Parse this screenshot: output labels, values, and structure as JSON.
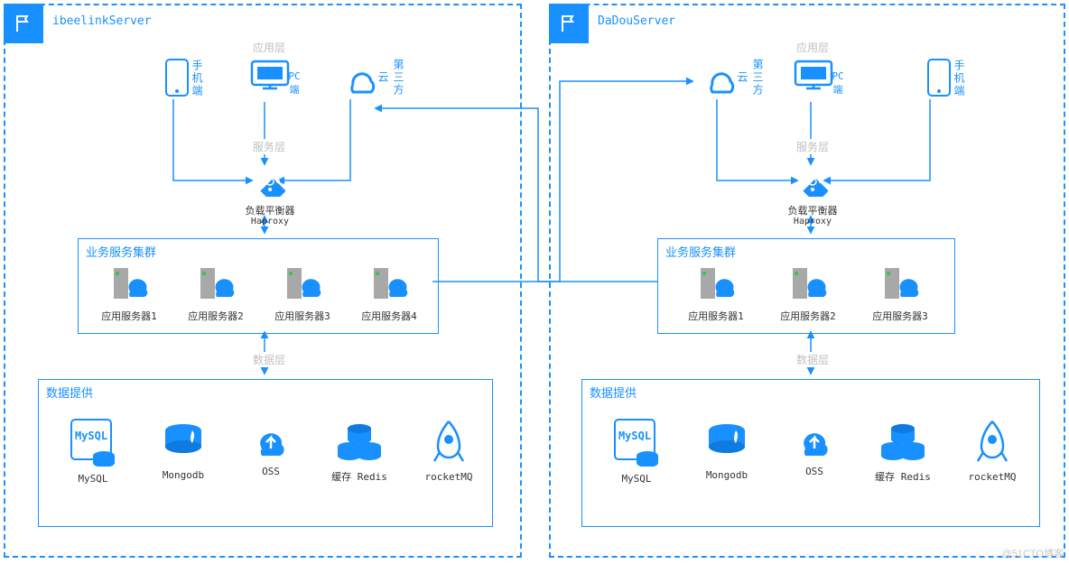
{
  "servers": {
    "left": {
      "title": "ibeelinkServer"
    },
    "right": {
      "title": "DaDouServer"
    }
  },
  "layers": {
    "app": "应用层",
    "service": "服务层",
    "data": "数据层"
  },
  "clients": {
    "mobile": "手机端",
    "pc": "PC端",
    "thirdparty": "第三方云"
  },
  "lb": {
    "label": "负载平衡器",
    "sub": "Haproxy"
  },
  "cluster": {
    "title": "业务服务集群"
  },
  "apps_left": [
    "应用服务器1",
    "应用服务器2",
    "应用服务器3",
    "应用服务器4"
  ],
  "apps_right": [
    "应用服务器1",
    "应用服务器2",
    "应用服务器3"
  ],
  "data_box": {
    "title": "数据提供"
  },
  "data_items": {
    "mysql": "MySQL",
    "mongodb": "Mongodb",
    "oss": "OSS",
    "redis": "缓存 Redis",
    "rocketmq": "rocketMQ"
  },
  "watermark": "@51CTO博客"
}
